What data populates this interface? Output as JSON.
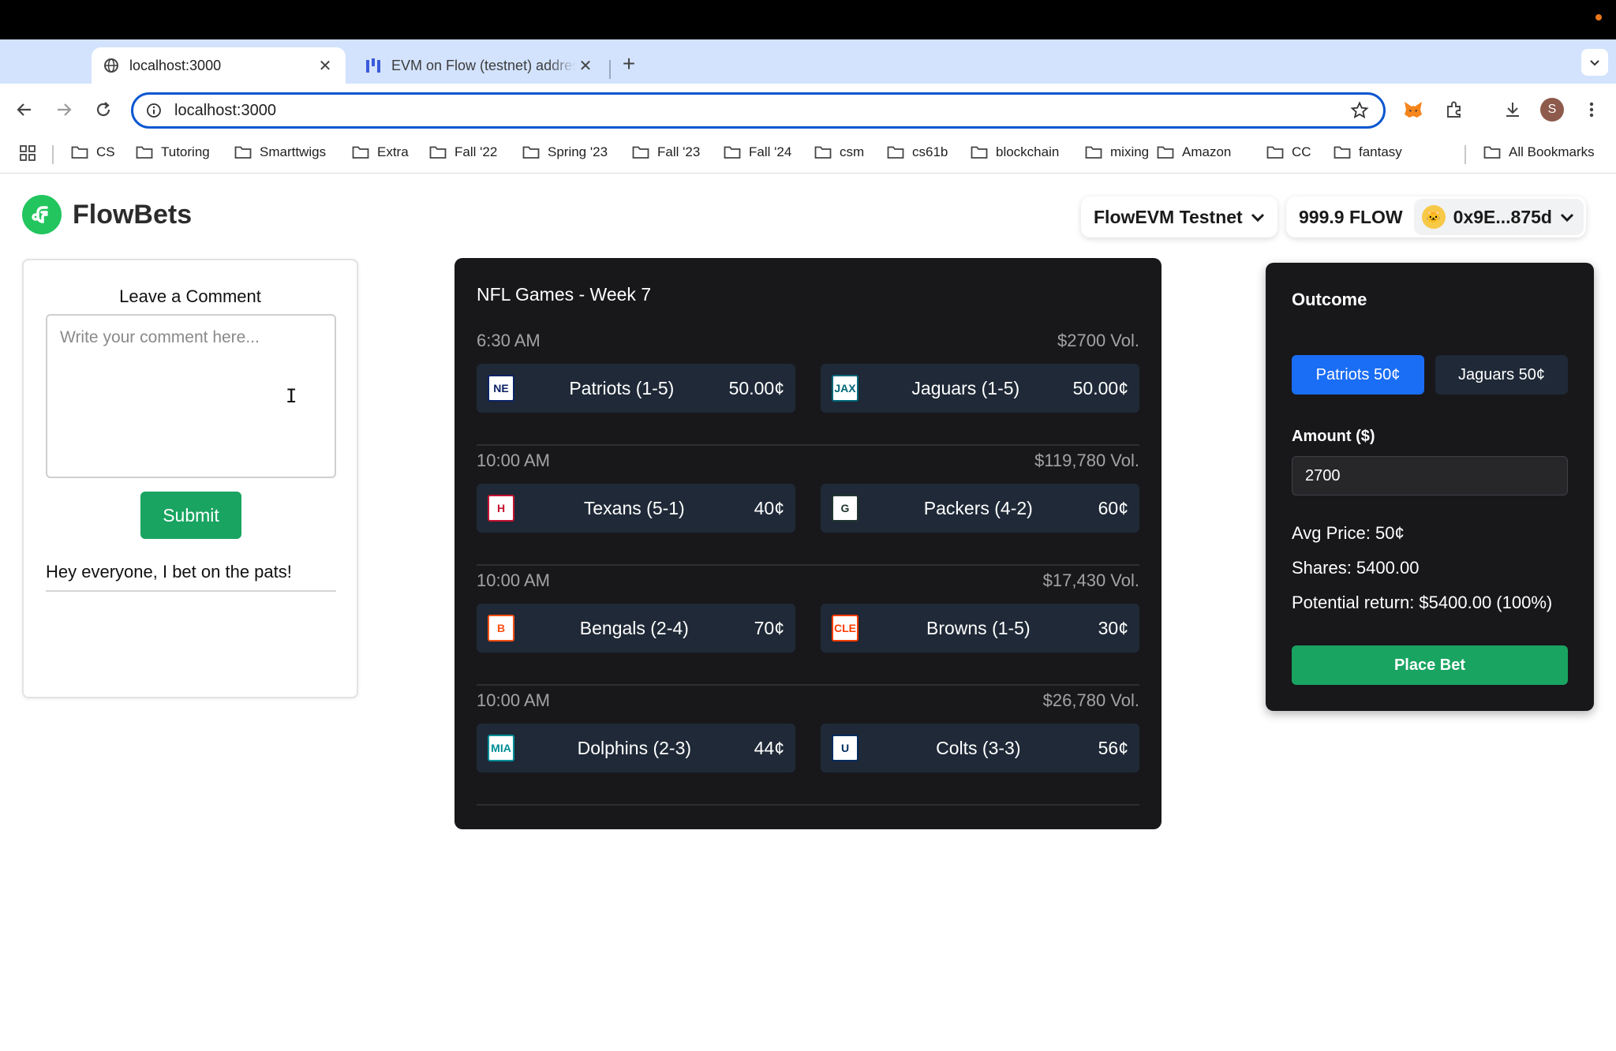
{
  "browser": {
    "tabs": [
      {
        "title": "localhost:3000",
        "active": true
      },
      {
        "title": "EVM on Flow (testnet) addres",
        "active": false
      }
    ],
    "new_tab": "+",
    "url": "localhost:3000",
    "profile_initial": "S",
    "bookmarks": [
      "CS",
      "Tutoring",
      "Smarttwigs",
      "Extra",
      "Fall '22",
      "Spring '23",
      "Fall '23",
      "Fall '24",
      "csm",
      "cs61b",
      "blockchain",
      "mixing",
      "Amazon",
      "CC",
      "fantasy"
    ],
    "all_bookmarks": "All Bookmarks"
  },
  "app": {
    "name": "FlowBets",
    "network": "FlowEVM Testnet",
    "balance": "999.9 FLOW",
    "address": "0x9E...875d",
    "avatar_emoji": "🐱"
  },
  "comments": {
    "heading": "Leave a Comment",
    "placeholder": "Write your comment here...",
    "submit_label": "Submit",
    "entries": [
      "Hey everyone, I bet on the pats!"
    ]
  },
  "games": {
    "title": "NFL Games - Week 7",
    "list": [
      {
        "time": "6:30 AM",
        "volume": "$2700 Vol.",
        "home": {
          "name": "Patriots (1-5)",
          "price": "50.00¢",
          "logo": "NE",
          "color": "#0b2265"
        },
        "away": {
          "name": "Jaguars (1-5)",
          "price": "50.00¢",
          "logo": "JAX",
          "color": "#006778"
        }
      },
      {
        "time": "10:00 AM",
        "volume": "$119,780 Vol.",
        "home": {
          "name": "Texans (5-1)",
          "price": "40¢",
          "logo": "H",
          "color": "#c41230"
        },
        "away": {
          "name": "Packers (4-2)",
          "price": "60¢",
          "logo": "G",
          "color": "#203731"
        }
      },
      {
        "time": "10:00 AM",
        "volume": "$17,430 Vol.",
        "home": {
          "name": "Bengals (2-4)",
          "price": "70¢",
          "logo": "B",
          "color": "#fb4f14"
        },
        "away": {
          "name": "Browns (1-5)",
          "price": "30¢",
          "logo": "CLE",
          "color": "#ff3c00"
        }
      },
      {
        "time": "10:00 AM",
        "volume": "$26,780 Vol.",
        "home": {
          "name": "Dolphins (2-3)",
          "price": "44¢",
          "logo": "MIA",
          "color": "#008e97"
        },
        "away": {
          "name": "Colts (3-3)",
          "price": "56¢",
          "logo": "U",
          "color": "#002c5f"
        }
      }
    ]
  },
  "outcome": {
    "title": "Outcome",
    "options": [
      "Patriots 50¢",
      "Jaguars 50¢"
    ],
    "amount_label": "Amount ($)",
    "amount_value": "2700",
    "avg_price": "Avg Price: 50¢",
    "shares": "Shares: 5400.00",
    "potential_return": "Potential return: $5400.00 (100%)",
    "place_label": "Place Bet"
  },
  "colors": {
    "accent_blue": "#1a6df5",
    "accent_green": "#19a461",
    "panel_dark": "#18181b",
    "tab_strip": "#d3e3fd"
  }
}
